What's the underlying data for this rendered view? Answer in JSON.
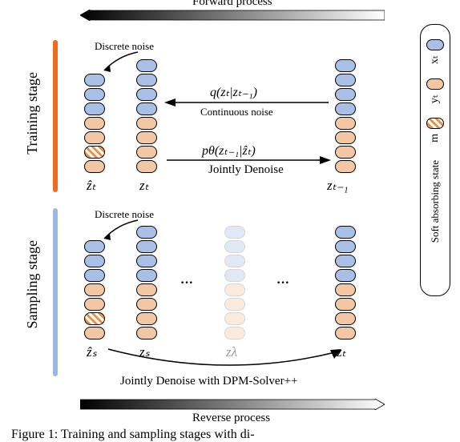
{
  "top_arrow_label": "Forward process",
  "bottom_arrow_label": "Reverse process",
  "training_stage_label": "Training stage",
  "sampling_stage_label": "Sampling stage",
  "discrete_noise_label_top": "Discrete noise",
  "discrete_noise_label_bot": "Discrete noise",
  "q_formula": "q(zₜ|zₜ₋₁)",
  "continuous_noise_label": "Continuous noise",
  "p_formula": "pθ(zₜ₋₁|ẑₜ)",
  "jointly_denoise_label": "Jointly Denoise",
  "jointly_denoise_dpm": "Jointly Denoise with DPM-Solver++",
  "zhat_t": "ẑₜ",
  "z_t": "zₜ",
  "z_tm1": "zₜ₋₁",
  "zhat_s": "ẑₛ",
  "z_s": "zₛ",
  "z_lambda": "zλ",
  "z_t2": "zₜ",
  "legend": {
    "x": "xₜ",
    "y": "yₜ",
    "m": "m",
    "m_desc": "Soft absorbing state"
  },
  "caption_prefix": "Figure 1:",
  "caption_text": " Training and sampling stages with di-"
}
